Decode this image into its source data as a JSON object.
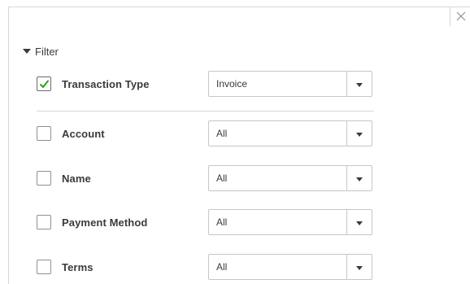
{
  "filter": {
    "label": "Filter",
    "rows": [
      {
        "label": "Transaction Type",
        "checked": true,
        "value": "Invoice"
      },
      {
        "label": "Account",
        "checked": false,
        "value": "All"
      },
      {
        "label": "Name",
        "checked": false,
        "value": "All"
      },
      {
        "label": "Payment Method",
        "checked": false,
        "value": "All"
      },
      {
        "label": "Terms",
        "checked": false,
        "value": "All"
      }
    ]
  },
  "icons": {
    "close": "close-icon",
    "collapse": "caret-down-icon",
    "check": "checkmark-icon",
    "dropdown": "dropdown-arrow-icon"
  },
  "colors": {
    "check": "#2ca01c",
    "border": "#c5c7cc",
    "text": "#393a3d"
  }
}
